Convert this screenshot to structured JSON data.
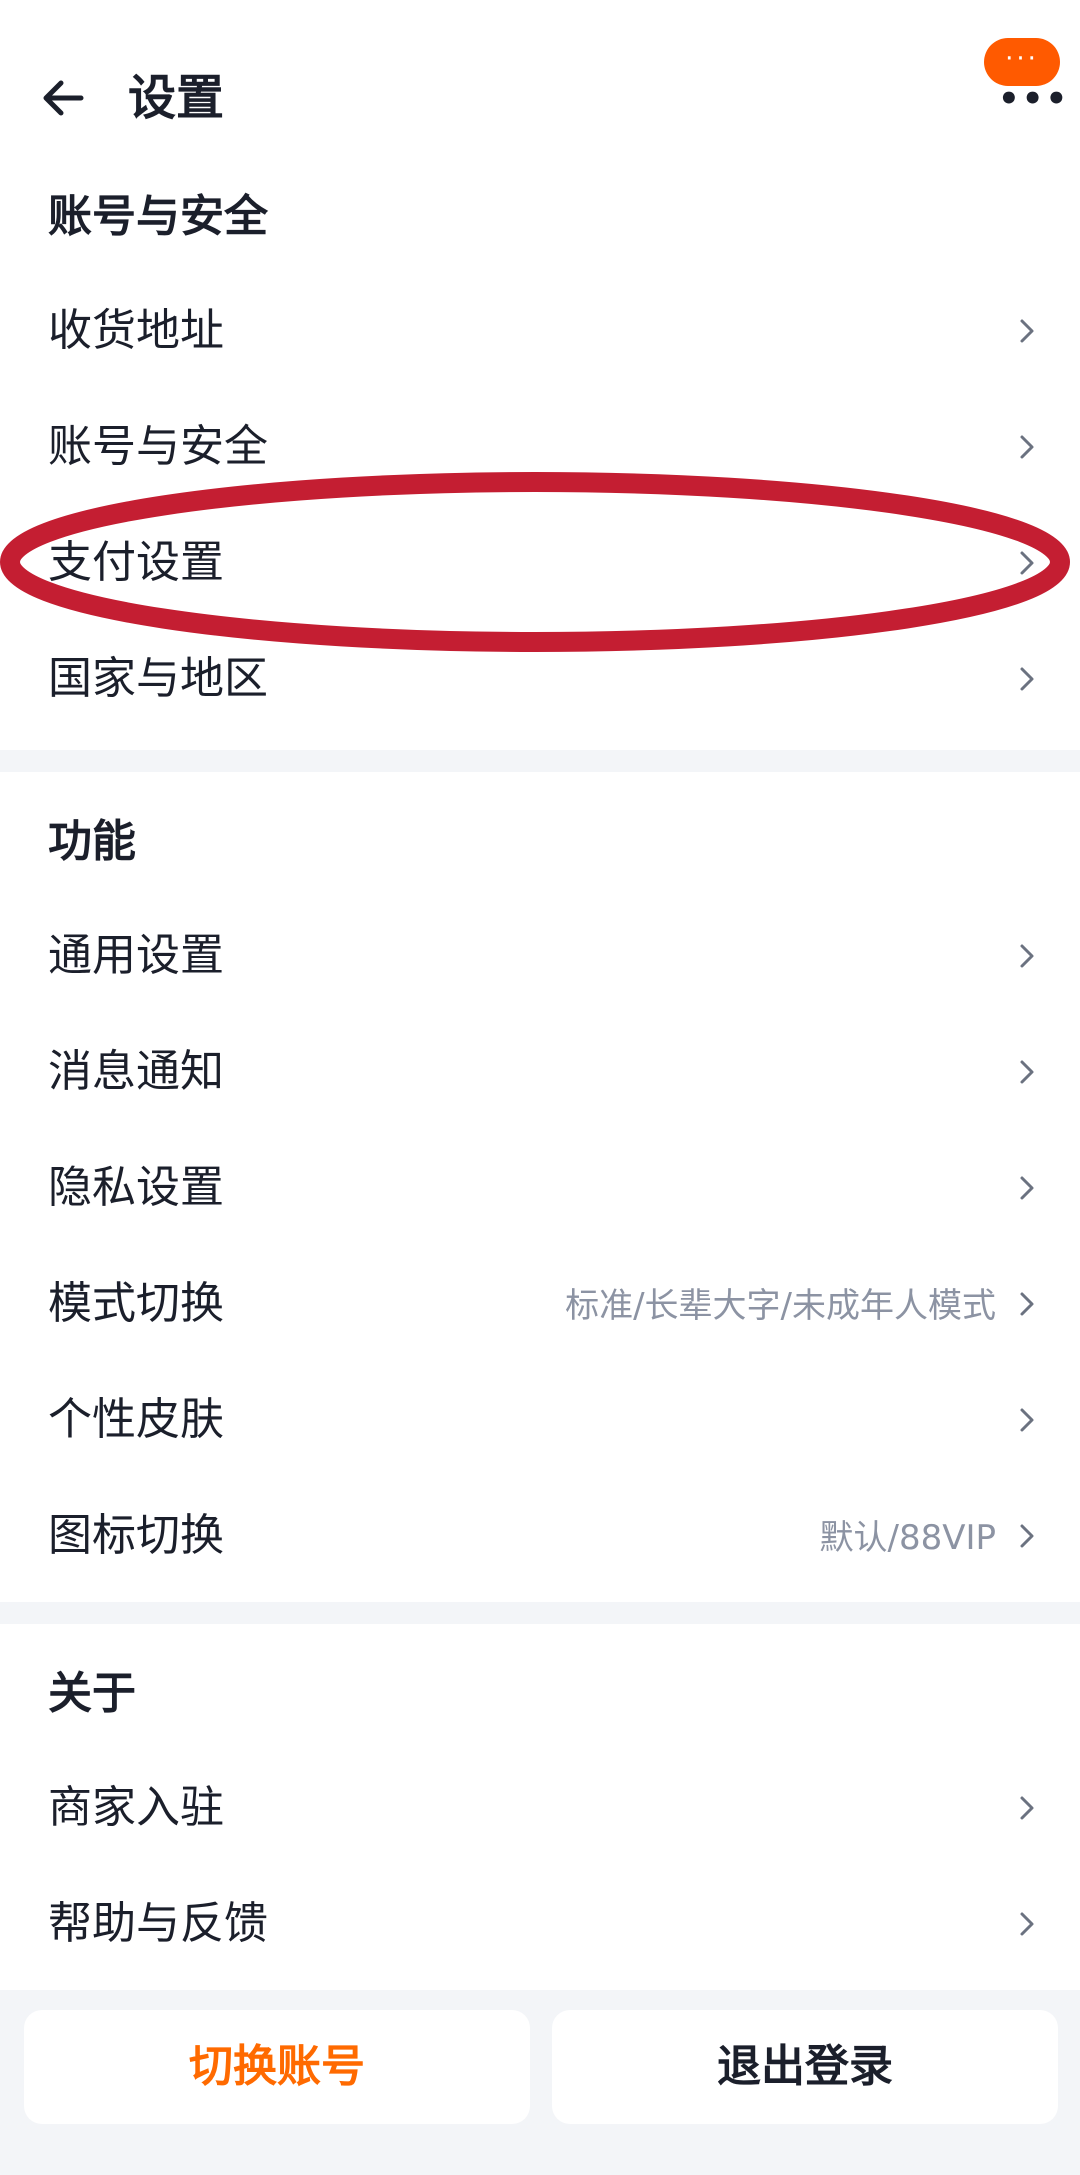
{
  "header": {
    "title": "设置",
    "back_icon": "arrow-left-icon",
    "more_icon": "more-dots-icon",
    "more_bubble": "···"
  },
  "sections": {
    "account": {
      "title": "账号与安全",
      "items": [
        {
          "label": "收货地址"
        },
        {
          "label": "账号与安全"
        },
        {
          "label": "支付设置"
        },
        {
          "label": "国家与地区"
        }
      ]
    },
    "features": {
      "title": "功能",
      "items": [
        {
          "label": "通用设置"
        },
        {
          "label": "消息通知"
        },
        {
          "label": "隐私设置"
        },
        {
          "label": "模式切换",
          "value": "标准/长辈大字/未成年人模式"
        },
        {
          "label": "个性皮肤"
        },
        {
          "label": "图标切换",
          "value": "默认/88VIP"
        }
      ]
    },
    "about": {
      "title": "关于",
      "items": [
        {
          "label": "商家入驻"
        },
        {
          "label": "帮助与反馈"
        }
      ]
    }
  },
  "actions": {
    "switch_account": "切换账号",
    "logout": "退出登录"
  },
  "colors": {
    "accent": "#ff6a00",
    "annotation": "#c41e32",
    "background": "#f3f5f8"
  }
}
